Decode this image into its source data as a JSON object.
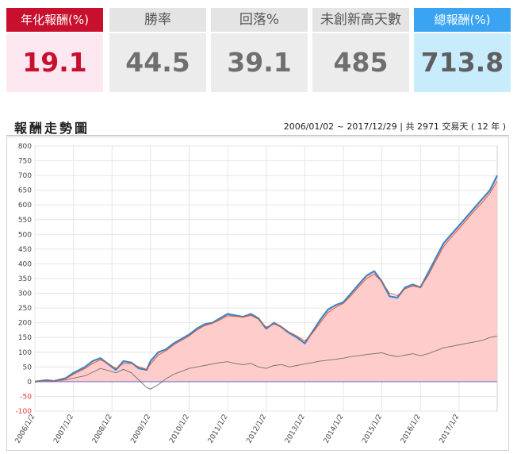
{
  "cards": [
    {
      "label": "年化報酬(%)",
      "value": "19.1"
    },
    {
      "label": "勝率",
      "value": "44.5"
    },
    {
      "label": "回落%",
      "value": "39.1"
    },
    {
      "label": "未創新高天數",
      "value": "485"
    },
    {
      "label": "總報酬(%)",
      "value": "713.8"
    }
  ],
  "panel": {
    "title": "報酬走勢圖",
    "range": "2006/01/02 ~ 2017/12/29 | 共 2971 交易天 ( 12 年 )"
  },
  "colors": {
    "accent_red": "#c8102e",
    "accent_blue": "#3aa3f2",
    "strategy_line": "#3d85c6",
    "area_fill": "#ffc9c9",
    "moving_avg": "#e0502a",
    "benchmark": "#6f6f6f",
    "negative_tick": "#e53935"
  },
  "chart_data": {
    "type": "line",
    "title": "報酬走勢圖",
    "xlabel": "",
    "ylabel": "",
    "ylim": [
      -100,
      800
    ],
    "yticks": [
      "800",
      "750",
      "700",
      "650",
      "600",
      "550",
      "500",
      "450",
      "400",
      "350",
      "300",
      "250",
      "200",
      "150",
      "100",
      "50",
      "0",
      "-50",
      "-100"
    ],
    "xticks": [
      "2006/1/2",
      "2007/1/2",
      "2008/1/2",
      "2009/1/2",
      "2010/1/2",
      "2011/1/2",
      "2012/1/2",
      "2013/1/2",
      "2014/1/2",
      "2015/1/2",
      "2016/1/2",
      "2017/1/2"
    ],
    "grid": true,
    "x": [
      2006.0,
      2006.3,
      2006.5,
      2006.8,
      2007.0,
      2007.3,
      2007.5,
      2007.7,
      2007.9,
      2008.1,
      2008.3,
      2008.5,
      2008.7,
      2008.9,
      2009.0,
      2009.2,
      2009.4,
      2009.6,
      2009.8,
      2010.0,
      2010.2,
      2010.4,
      2010.6,
      2010.8,
      2011.0,
      2011.2,
      2011.4,
      2011.6,
      2011.8,
      2012.0,
      2012.2,
      2012.4,
      2012.6,
      2012.8,
      2013.0,
      2013.2,
      2013.4,
      2013.6,
      2013.8,
      2014.0,
      2014.2,
      2014.4,
      2014.6,
      2014.8,
      2015.0,
      2015.2,
      2015.4,
      2015.6,
      2015.8,
      2016.0,
      2016.2,
      2016.4,
      2016.6,
      2016.8,
      2017.0,
      2017.2,
      2017.4,
      2017.6,
      2017.8,
      2017.99
    ],
    "series": [
      {
        "role": "strategy",
        "style": "blue line with pink area",
        "values": [
          0,
          5,
          2,
          12,
          30,
          50,
          70,
          80,
          60,
          40,
          70,
          65,
          45,
          40,
          70,
          100,
          110,
          130,
          145,
          160,
          180,
          195,
          200,
          215,
          230,
          225,
          220,
          230,
          215,
          180,
          200,
          185,
          165,
          150,
          130,
          170,
          210,
          245,
          260,
          270,
          300,
          330,
          360,
          375,
          340,
          290,
          285,
          320,
          330,
          320,
          370,
          420,
          470,
          500,
          530,
          560,
          590,
          620,
          650,
          700
        ]
      },
      {
        "role": "moving-average",
        "style": "orange thin line",
        "values": [
          0,
          3,
          3,
          10,
          25,
          45,
          62,
          74,
          62,
          45,
          62,
          62,
          50,
          42,
          60,
          90,
          105,
          125,
          140,
          155,
          175,
          190,
          198,
          210,
          224,
          222,
          219,
          225,
          212,
          185,
          196,
          186,
          168,
          155,
          138,
          165,
          200,
          235,
          252,
          266,
          292,
          322,
          350,
          365,
          340,
          300,
          292,
          315,
          325,
          320,
          360,
          410,
          458,
          490,
          520,
          550,
          580,
          608,
          640,
          680
        ]
      },
      {
        "role": "benchmark",
        "style": "gray thin line",
        "values": [
          0,
          3,
          2,
          6,
          12,
          20,
          32,
          45,
          38,
          30,
          42,
          30,
          5,
          -20,
          -25,
          -10,
          10,
          25,
          35,
          45,
          50,
          55,
          60,
          65,
          68,
          62,
          58,
          62,
          50,
          45,
          55,
          58,
          50,
          55,
          60,
          65,
          70,
          73,
          76,
          80,
          85,
          88,
          92,
          95,
          98,
          90,
          85,
          90,
          95,
          88,
          95,
          105,
          115,
          120,
          125,
          130,
          135,
          140,
          150,
          155
        ]
      }
    ]
  }
}
